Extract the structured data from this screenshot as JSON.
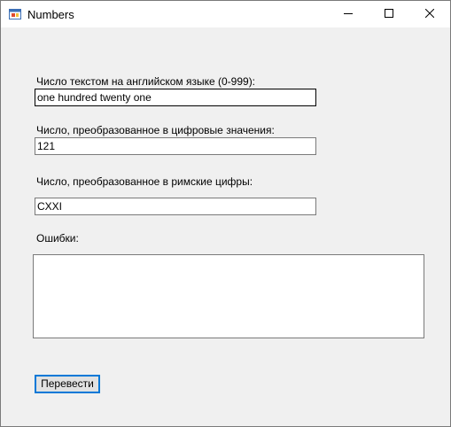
{
  "window": {
    "title": "Numbers"
  },
  "titlebar": {
    "minimize_icon": "minimize-icon",
    "maximize_icon": "maximize-icon",
    "close_icon": "close-icon"
  },
  "form": {
    "english_label": "Число текстом на английском языке (0-999):",
    "english_value": "one hundred twenty one",
    "digits_label": "Число, преобразованное в цифровые значения:",
    "digits_value": "121",
    "roman_label": "Число, преобразованное в римские цифры:",
    "roman_value": "CXXI",
    "errors_label": "Ошибки:",
    "errors_value": "",
    "convert_button": "Перевести"
  }
}
